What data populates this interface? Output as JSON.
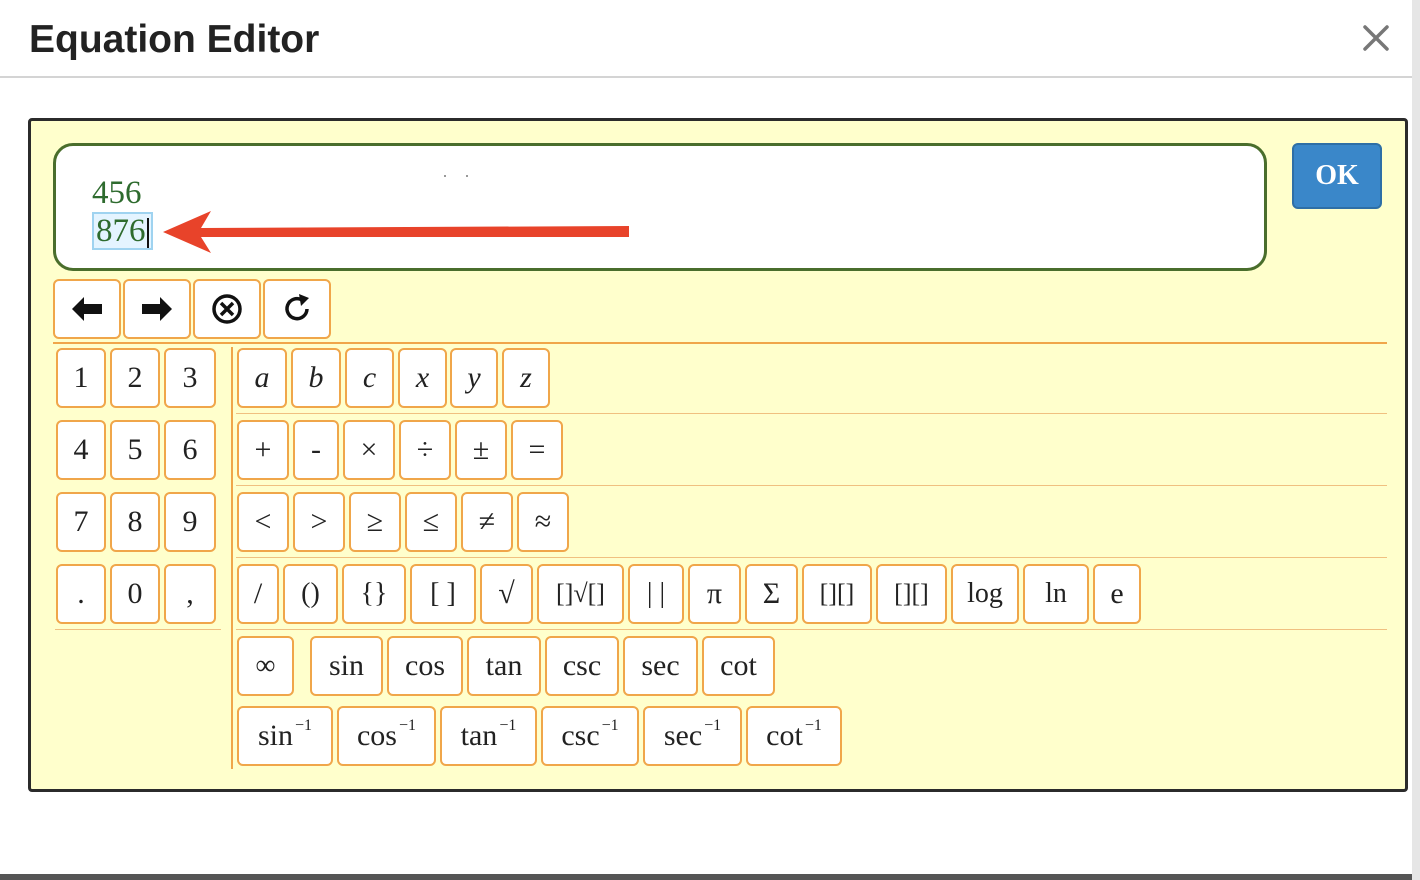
{
  "dialog": {
    "title": "Equation Editor"
  },
  "editor": {
    "numerator": "456",
    "denominator": "876"
  },
  "ok_label": "OK",
  "nav_buttons": [
    {
      "name": "left-arrow-button",
      "icon": "arrow-left-icon"
    },
    {
      "name": "right-arrow-button",
      "icon": "arrow-right-icon"
    },
    {
      "name": "clear-button",
      "icon": "circle-x-icon"
    },
    {
      "name": "refresh-button",
      "icon": "refresh-icon"
    }
  ],
  "keys": {
    "digits": [
      [
        "1",
        "2",
        "3"
      ],
      [
        "4",
        "5",
        "6"
      ],
      [
        "7",
        "8",
        "9"
      ],
      [
        ".",
        "0",
        ","
      ]
    ],
    "variables": [
      "a",
      "b",
      "c",
      "x",
      "y",
      "z"
    ],
    "operators": [
      "+",
      "-",
      "×",
      "÷",
      "±",
      "="
    ],
    "relations": [
      "<",
      ">",
      "≥",
      "≤",
      "≠",
      "≈"
    ],
    "structures": [
      "/",
      "()",
      "{}",
      "[ ]",
      "√",
      "[]√[]",
      "| |",
      "π",
      "Σ",
      "[][]",
      "[][]",
      "log",
      "ln",
      "e"
    ],
    "trig": [
      "∞",
      "sin",
      "cos",
      "tan",
      "csc",
      "sec",
      "cot"
    ],
    "inverse_trig": [
      "sin",
      "cos",
      "tan",
      "csc",
      "sec",
      "cot"
    ],
    "inverse_exponent": "−1"
  },
  "colors": {
    "editor_bg": "#ffffcc",
    "key_border": "#f0a64a",
    "input_border": "#4a6e2c",
    "math_text": "#2e6b2e",
    "ok_bg": "#3a87c9",
    "annotation_arrow": "#e8432a"
  }
}
